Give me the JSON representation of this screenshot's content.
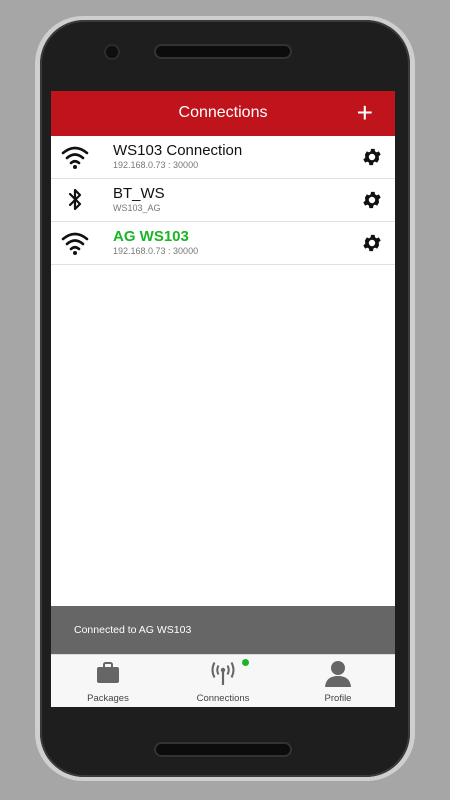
{
  "appbar": {
    "title": "Connections",
    "add_label": "+"
  },
  "connections": [
    {
      "title": "WS103 Connection",
      "subtitle": "192.168.0.73 : 30000",
      "icon": "wifi-icon",
      "connected": false
    },
    {
      "title": "BT_WS",
      "subtitle": "WS103_AG",
      "icon": "bluetooth-icon",
      "connected": false
    },
    {
      "title": "AG WS103",
      "subtitle": "192.168.0.73 : 30000",
      "icon": "wifi-icon",
      "connected": true
    }
  ],
  "snackbar": {
    "text": "Connected to AG WS103"
  },
  "nav": {
    "items": [
      {
        "label": "Packages",
        "icon": "briefcase-icon"
      },
      {
        "label": "Connections",
        "icon": "antenna-icon",
        "active_indicator": true
      },
      {
        "label": "Profile",
        "icon": "person-icon"
      }
    ]
  },
  "colors": {
    "accent": "#c0141c",
    "connected": "#1bb526",
    "snackbar": "#666666"
  }
}
